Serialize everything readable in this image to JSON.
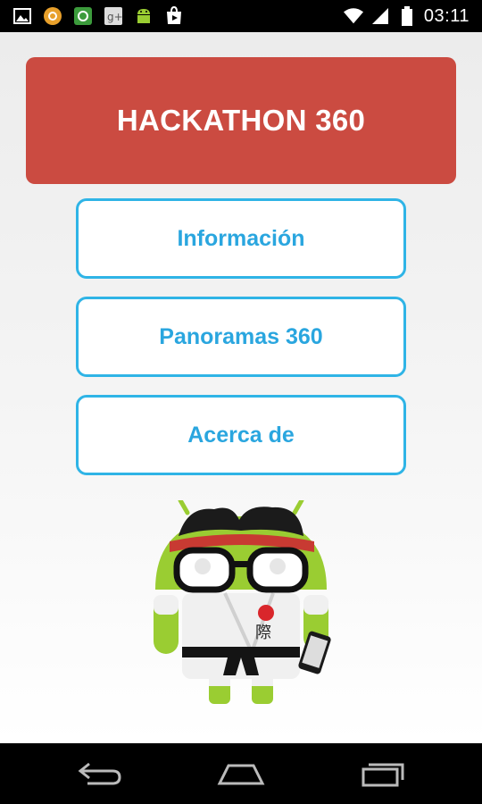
{
  "status_bar": {
    "time": "03:11",
    "left_icons": [
      "image-icon",
      "chrome-icon",
      "store-icon",
      "google-plus-icon",
      "android-debug-icon",
      "play-store-icon"
    ],
    "right_icons": [
      "wifi-icon",
      "signal-icon",
      "battery-icon"
    ]
  },
  "header": {
    "title": "HACKATHON 360",
    "color": "#cb4b41"
  },
  "menu": {
    "items": [
      {
        "label": "Información"
      },
      {
        "label": "Panoramas 360"
      },
      {
        "label": "Acerca de"
      }
    ],
    "accent_color": "#2fb4e6"
  },
  "mascot": {
    "name": "android-karate-mascot-icon",
    "badge_char": "際"
  },
  "nav_bar": {
    "icons": [
      "back-icon",
      "home-icon",
      "recents-icon"
    ]
  }
}
